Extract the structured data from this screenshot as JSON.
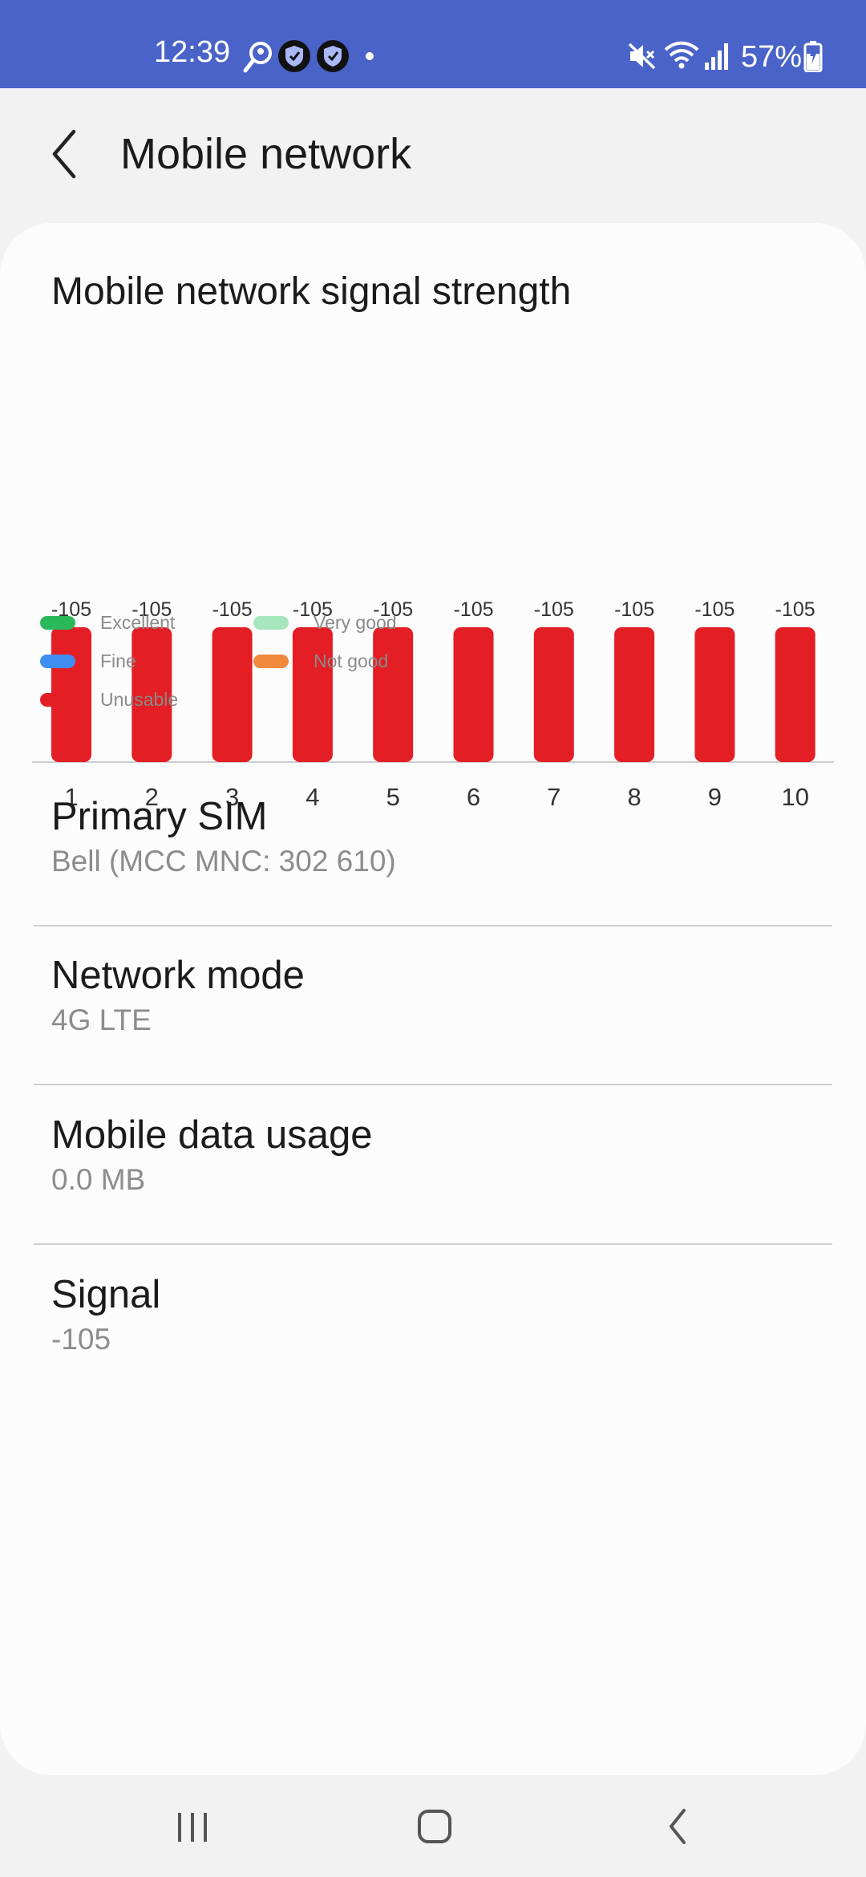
{
  "status_bar": {
    "time": "12:39",
    "battery": "57%",
    "icons": [
      "location-search-icon",
      "shield-icon",
      "shield-icon",
      "notification-dot-icon",
      "mute-icon",
      "wifi-icon",
      "signal-bars-icon",
      "battery-charging-icon"
    ]
  },
  "header": {
    "title": "Mobile network",
    "back_icon": "chevron-left-icon"
  },
  "chart": {
    "title": "Mobile network signal strength"
  },
  "chart_data": {
    "type": "bar",
    "categories": [
      "1",
      "2",
      "3",
      "4",
      "5",
      "6",
      "7",
      "8",
      "9",
      "10"
    ],
    "values": [
      -105,
      -105,
      -105,
      -105,
      -105,
      -105,
      -105,
      -105,
      -105,
      -105
    ],
    "value_labels": [
      "-105",
      "-105",
      "-105",
      "-105",
      "-105",
      "-105",
      "-105",
      "-105",
      "-105",
      "-105"
    ],
    "bar_status": [
      "Unusable",
      "Unusable",
      "Unusable",
      "Unusable",
      "Unusable",
      "Unusable",
      "Unusable",
      "Unusable",
      "Unusable",
      "Unusable"
    ],
    "colors": {
      "Excellent": "#2bb85a",
      "Very good": "#a6e6bd",
      "Fine": "#3e8ef0",
      "Not good": "#ef8a3c",
      "Unusable": "#e31e24"
    },
    "legend": [
      "Excellent",
      "Very good",
      "Fine",
      "Not good",
      "Unusable"
    ],
    "legend_placement": "bottom-left",
    "grid": false
  },
  "list": [
    {
      "title": "Primary SIM",
      "subtitle": "Bell (MCC MNC: 302 610)"
    },
    {
      "title": "Network mode",
      "subtitle": "4G LTE"
    },
    {
      "title": "Mobile data usage",
      "subtitle": "0.0 MB"
    },
    {
      "title": "Signal",
      "subtitle": "-105"
    }
  ],
  "nav_bar": {
    "icons": [
      "recent-apps-icon",
      "home-icon",
      "back-icon"
    ]
  },
  "colors": {
    "status_bar": "#4a63c8",
    "background": "#f2f2f2",
    "card": "#fcfcfc",
    "secondary_text": "#8c8c8c"
  }
}
